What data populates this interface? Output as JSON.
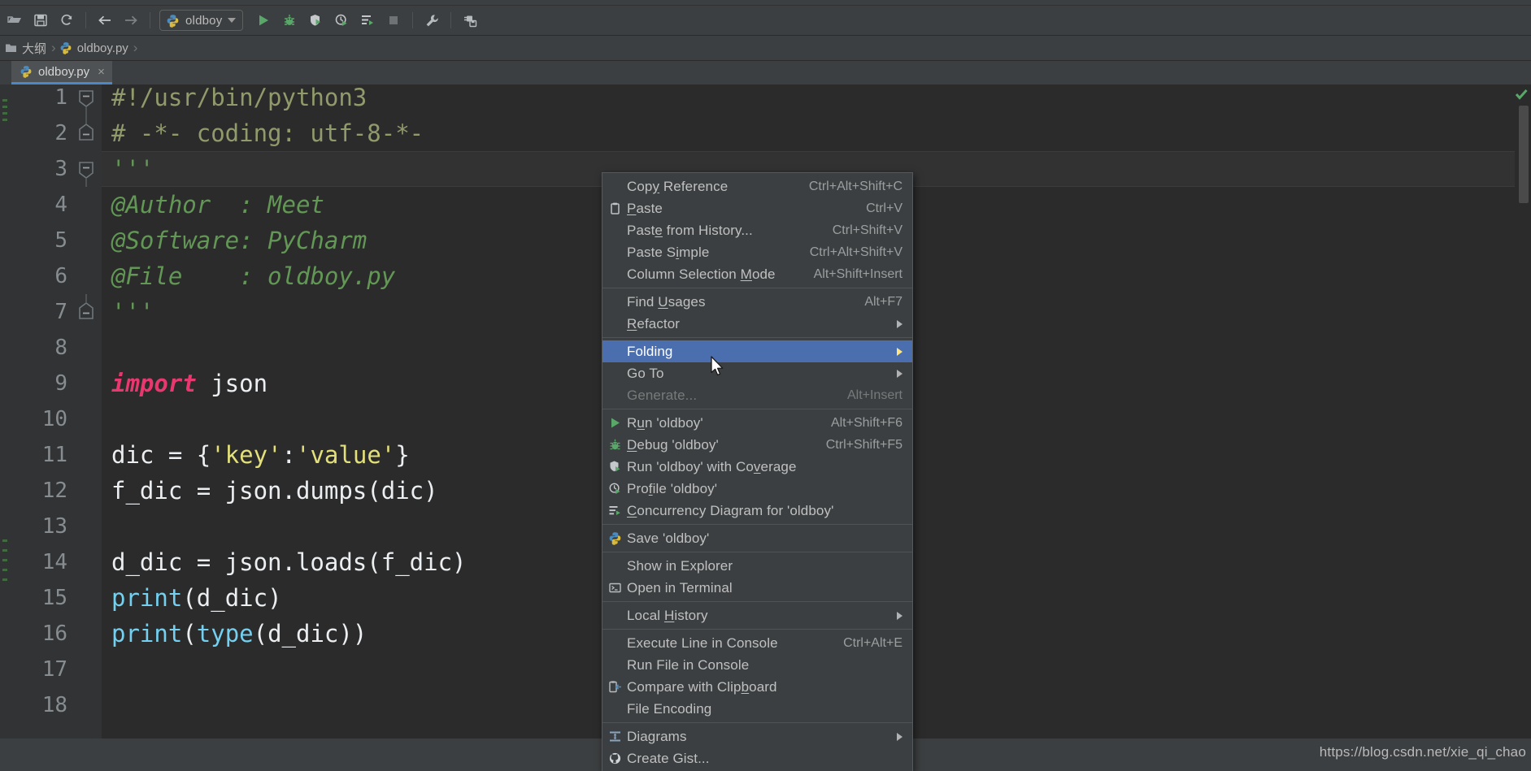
{
  "window": {
    "app": "PyCharm",
    "watermark": "https://blog.csdn.net/xie_qi_chao"
  },
  "toolbar": {
    "buttons": [
      {
        "name": "open-folder-icon",
        "label": "Open"
      },
      {
        "name": "save-all-icon",
        "label": "Save All"
      },
      {
        "name": "sync-icon",
        "label": "Synchronize"
      },
      {
        "name": "back-arrow-icon",
        "label": "Back"
      },
      {
        "name": "forward-arrow-icon",
        "label": "Forward"
      }
    ],
    "run_config": {
      "label": "oldboy",
      "icon": "python-file-icon"
    },
    "run_buttons": [
      {
        "name": "run-icon",
        "label": "Run"
      },
      {
        "name": "debug-icon",
        "label": "Debug"
      },
      {
        "name": "run-with-coverage-icon",
        "label": "Run with Coverage"
      },
      {
        "name": "profile-icon",
        "label": "Profile"
      },
      {
        "name": "concurrency-diagram-icon",
        "label": "Concurrency Diagram"
      },
      {
        "name": "stop-icon",
        "label": "Stop"
      }
    ],
    "right_buttons": [
      {
        "name": "settings-wrench-icon",
        "label": "Settings"
      },
      {
        "name": "plugins-icon",
        "label": "Plugins"
      }
    ]
  },
  "breadcrumb": {
    "items": [
      {
        "label": "大纲",
        "icon": "folder-icon"
      },
      {
        "label": "oldboy.py",
        "icon": "python-file-icon"
      }
    ],
    "separator": "›"
  },
  "tabs": [
    {
      "label": "oldboy.py",
      "icon": "python-file-icon",
      "close": "×",
      "active": true
    }
  ],
  "editor": {
    "lines": [
      {
        "n": "1",
        "tokens": [
          {
            "t": "comment",
            "s": "#!/usr/bin/python3"
          }
        ],
        "fold": "collapse"
      },
      {
        "n": "2",
        "tokens": [
          {
            "t": "comment",
            "s": "# -*- coding: utf-8-*-"
          }
        ],
        "fold": "collapse-end"
      },
      {
        "n": "3",
        "tokens": [
          {
            "t": "doc",
            "s": "'''"
          }
        ],
        "fold": "collapse",
        "caret": true
      },
      {
        "n": "4",
        "tokens": [
          {
            "t": "doc",
            "s": "@Author  : Meet"
          }
        ]
      },
      {
        "n": "5",
        "tokens": [
          {
            "t": "doc",
            "s": "@Software: PyCharm"
          }
        ]
      },
      {
        "n": "6",
        "tokens": [
          {
            "t": "doc",
            "s": "@File    : oldboy.py"
          }
        ]
      },
      {
        "n": "7",
        "tokens": [
          {
            "t": "doc",
            "s": "'''"
          }
        ],
        "fold": "collapse-end"
      },
      {
        "n": "8",
        "tokens": []
      },
      {
        "n": "9",
        "tokens": [
          {
            "t": "kw",
            "s": "import"
          },
          {
            "t": "plain",
            "s": " json"
          }
        ]
      },
      {
        "n": "10",
        "tokens": []
      },
      {
        "n": "11",
        "tokens": [
          {
            "t": "plain",
            "s": "dic = "
          },
          {
            "t": "brace",
            "s": "{"
          },
          {
            "t": "str",
            "s": "'key'"
          },
          {
            "t": "plain",
            "s": ":"
          },
          {
            "t": "str",
            "s": "'value'"
          },
          {
            "t": "brace",
            "s": "}"
          }
        ]
      },
      {
        "n": "12",
        "tokens": [
          {
            "t": "plain",
            "s": "f_dic = json.dumps(dic)"
          }
        ]
      },
      {
        "n": "13",
        "tokens": []
      },
      {
        "n": "14",
        "tokens": [
          {
            "t": "plain",
            "s": "d_dic = json.loads(f_dic)"
          }
        ]
      },
      {
        "n": "15",
        "tokens": [
          {
            "t": "builtin",
            "s": "print"
          },
          {
            "t": "plain",
            "s": "(d_dic)"
          }
        ]
      },
      {
        "n": "16",
        "tokens": [
          {
            "t": "builtin",
            "s": "print"
          },
          {
            "t": "plain",
            "s": "("
          },
          {
            "t": "builtin",
            "s": "type"
          },
          {
            "t": "plain",
            "s": "(d_dic))"
          }
        ]
      },
      {
        "n": "17",
        "tokens": []
      },
      {
        "n": "18",
        "tokens": []
      }
    ],
    "inspection_status": "ok"
  },
  "context_menu": {
    "items": [
      {
        "label": "Copy Reference",
        "mnemonic": "y",
        "key": "Ctrl+Alt+Shift+C",
        "icon": null
      },
      {
        "label": "Paste",
        "mnemonic": "P",
        "key": "Ctrl+V",
        "icon": "clipboard-icon"
      },
      {
        "label": "Paste from History...",
        "mnemonic": "e",
        "key": "Ctrl+Shift+V",
        "icon": null
      },
      {
        "label": "Paste Simple",
        "mnemonic": "i",
        "key": "Ctrl+Alt+Shift+V",
        "icon": null
      },
      {
        "label": "Column Selection Mode",
        "mnemonic": "M",
        "key": "Alt+Shift+Insert",
        "icon": null
      },
      {
        "separator": true
      },
      {
        "label": "Find Usages",
        "mnemonic": "U",
        "key": "Alt+F7",
        "icon": null
      },
      {
        "label": "Refactor",
        "mnemonic": "R",
        "key": "",
        "icon": null,
        "submenu": true
      },
      {
        "separator": true
      },
      {
        "label": "Folding",
        "mnemonic": "",
        "key": "",
        "icon": null,
        "submenu": true,
        "selected": true
      },
      {
        "label": "Go To",
        "mnemonic": "",
        "key": "",
        "icon": null,
        "submenu": true
      },
      {
        "label": "Generate...",
        "mnemonic": "",
        "key": "Alt+Insert",
        "icon": null,
        "disabled": true
      },
      {
        "separator": true
      },
      {
        "label": "Run 'oldboy'",
        "mnemonic": "u",
        "key": "Alt+Shift+F6",
        "icon": "run-icon"
      },
      {
        "label": "Debug 'oldboy'",
        "mnemonic": "D",
        "key": "Ctrl+Shift+F5",
        "icon": "debug-icon"
      },
      {
        "label": "Run 'oldboy' with Coverage",
        "mnemonic": "v",
        "key": "",
        "icon": "coverage-icon"
      },
      {
        "label": "Profile 'oldboy'",
        "mnemonic": "f",
        "key": "",
        "icon": "profile-icon"
      },
      {
        "label": "Concurrency Diagram for 'oldboy'",
        "mnemonic": "C",
        "key": "",
        "icon": "concurrency-icon"
      },
      {
        "separator": true
      },
      {
        "label": "Save 'oldboy'",
        "mnemonic": "",
        "key": "",
        "icon": "python-file-icon"
      },
      {
        "separator": true
      },
      {
        "label": "Show in Explorer",
        "mnemonic": "",
        "key": "",
        "icon": null
      },
      {
        "label": "Open in Terminal",
        "mnemonic": "",
        "key": "",
        "icon": "terminal-icon"
      },
      {
        "separator": true
      },
      {
        "label": "Local History",
        "mnemonic": "H",
        "key": "",
        "icon": null,
        "submenu": true
      },
      {
        "separator": true
      },
      {
        "label": "Execute Line in Console",
        "mnemonic": "",
        "key": "Ctrl+Alt+E",
        "icon": null
      },
      {
        "label": "Run File in Console",
        "mnemonic": "",
        "key": "",
        "icon": null
      },
      {
        "label": "Compare with Clipboard",
        "mnemonic": "b",
        "key": "",
        "icon": "compare-icon"
      },
      {
        "label": "File Encoding",
        "mnemonic": "",
        "key": "",
        "icon": null
      },
      {
        "separator": true
      },
      {
        "label": "Diagrams",
        "mnemonic": "",
        "key": "",
        "icon": "diagrams-icon",
        "submenu": true
      },
      {
        "label": "Create Gist...",
        "mnemonic": "",
        "key": "",
        "icon": "github-icon"
      }
    ]
  }
}
